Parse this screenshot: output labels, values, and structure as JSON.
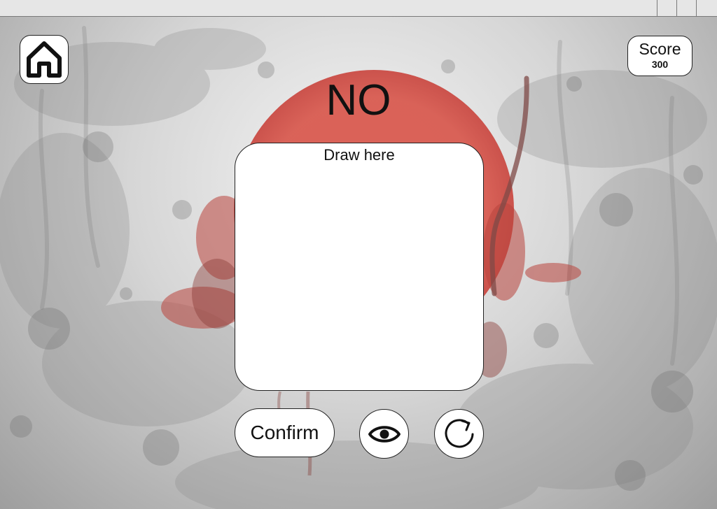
{
  "header": {
    "home_icon": "home-icon",
    "score_label": "Score",
    "score_value": "300"
  },
  "headline": "NO",
  "canvas": {
    "label": "Draw here"
  },
  "actions": {
    "confirm_label": "Confirm",
    "eye_icon": "eye-icon",
    "refresh_icon": "refresh-icon"
  },
  "colors": {
    "accent_red": "#d9534a",
    "stroke": "#222222",
    "panel": "#ffffff"
  }
}
